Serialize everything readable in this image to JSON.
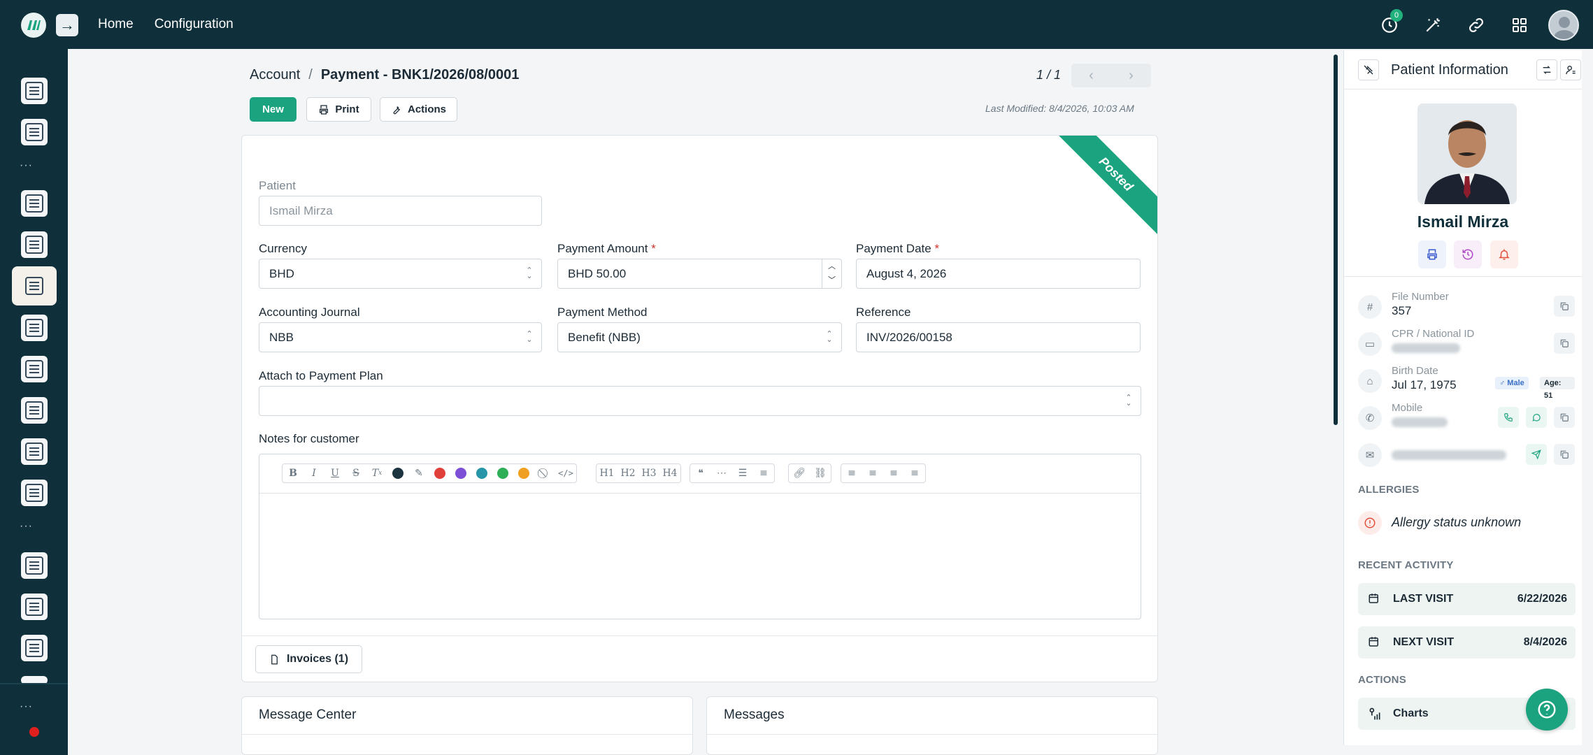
{
  "topbar": {
    "nav": [
      "Home",
      "Configuration"
    ],
    "notification_count": "0"
  },
  "breadcrumb": {
    "parent": "Account",
    "separator": "/",
    "current": "Payment - BNK1/2026/08/0001"
  },
  "pager": {
    "text": "1 / 1"
  },
  "toolbar": {
    "new_label": "New",
    "print_label": "Print",
    "actions_label": "Actions",
    "last_modified": "Last Modified: 8/4/2026, 10:03 AM"
  },
  "form": {
    "status_ribbon": "Posted",
    "patient": {
      "label": "Patient",
      "value": "Ismail Mirza"
    },
    "currency": {
      "label": "Currency",
      "value": "BHD"
    },
    "payment_amount": {
      "label": "Payment Amount",
      "value": "BHD 50.00",
      "required": "*"
    },
    "payment_date": {
      "label": "Payment Date",
      "value": "August 4, 2026",
      "required": "*"
    },
    "accounting_journal": {
      "label": "Accounting Journal",
      "value": "NBB"
    },
    "payment_method": {
      "label": "Payment Method",
      "value": "Benefit (NBB)"
    },
    "reference": {
      "label": "Reference",
      "value": "INV/2026/00158"
    },
    "payment_plan": {
      "label": "Attach to Payment Plan",
      "value": ""
    },
    "notes": {
      "label": "Notes for customer"
    },
    "editor_headings": [
      "H1",
      "H2",
      "H3",
      "H4"
    ],
    "editor_colors": [
      "#1c3340",
      "#e0403a",
      "#7c4fd6",
      "#2696a8",
      "#2fae58",
      "#f0a020"
    ],
    "invoices_label": "Invoices (1)"
  },
  "bottom_cards": [
    "Message Center",
    "Messages"
  ],
  "patient_panel": {
    "title": "Patient Information",
    "name": "Ismail Mirza",
    "file_number": {
      "label": "File Number",
      "value": "357"
    },
    "cpr": {
      "label": "CPR / National ID"
    },
    "birth_date": {
      "label": "Birth Date",
      "value": "Jul 17, 1975"
    },
    "gender": "♂ Male",
    "age": "Age: 51",
    "mobile": {
      "label": "Mobile"
    },
    "allergies_title": "ALLERGIES",
    "allergy_status": "Allergy status unknown",
    "recent_activity_title": "RECENT ACTIVITY",
    "last_visit": {
      "label": "LAST VISIT",
      "value": "6/22/2026"
    },
    "next_visit": {
      "label": "NEXT VISIT",
      "value": "8/4/2026"
    },
    "actions_title": "ACTIONS",
    "charts_label": "Charts"
  }
}
